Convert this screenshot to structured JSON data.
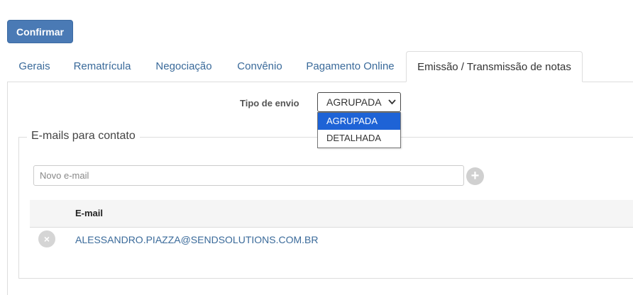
{
  "toolbar": {
    "confirm_label": "Confirmar"
  },
  "tabs": [
    {
      "label": "Gerais"
    },
    {
      "label": "Rematrícula"
    },
    {
      "label": "Negociação"
    },
    {
      "label": "Convênio"
    },
    {
      "label": "Pagamento Online"
    },
    {
      "label": "Emissão / Transmissão de notas",
      "active": true
    }
  ],
  "envio": {
    "label": "Tipo de envio",
    "selected": "AGRUPADA",
    "options": [
      "AGRUPADA",
      "DETALHADA"
    ]
  },
  "contatos": {
    "legend": "E-mails para contato",
    "input_placeholder": "Novo e-mail",
    "add_icon": "+",
    "remove_icon": "×",
    "column_email": "E-mail",
    "emails": [
      "ALESSANDRO.PIAZZA@SENDSOLUTIONS.COM.BR"
    ]
  },
  "colors": {
    "primary": "#4a7ab5",
    "link": "#3a6a9a",
    "option_highlight": "#1e63d6"
  }
}
